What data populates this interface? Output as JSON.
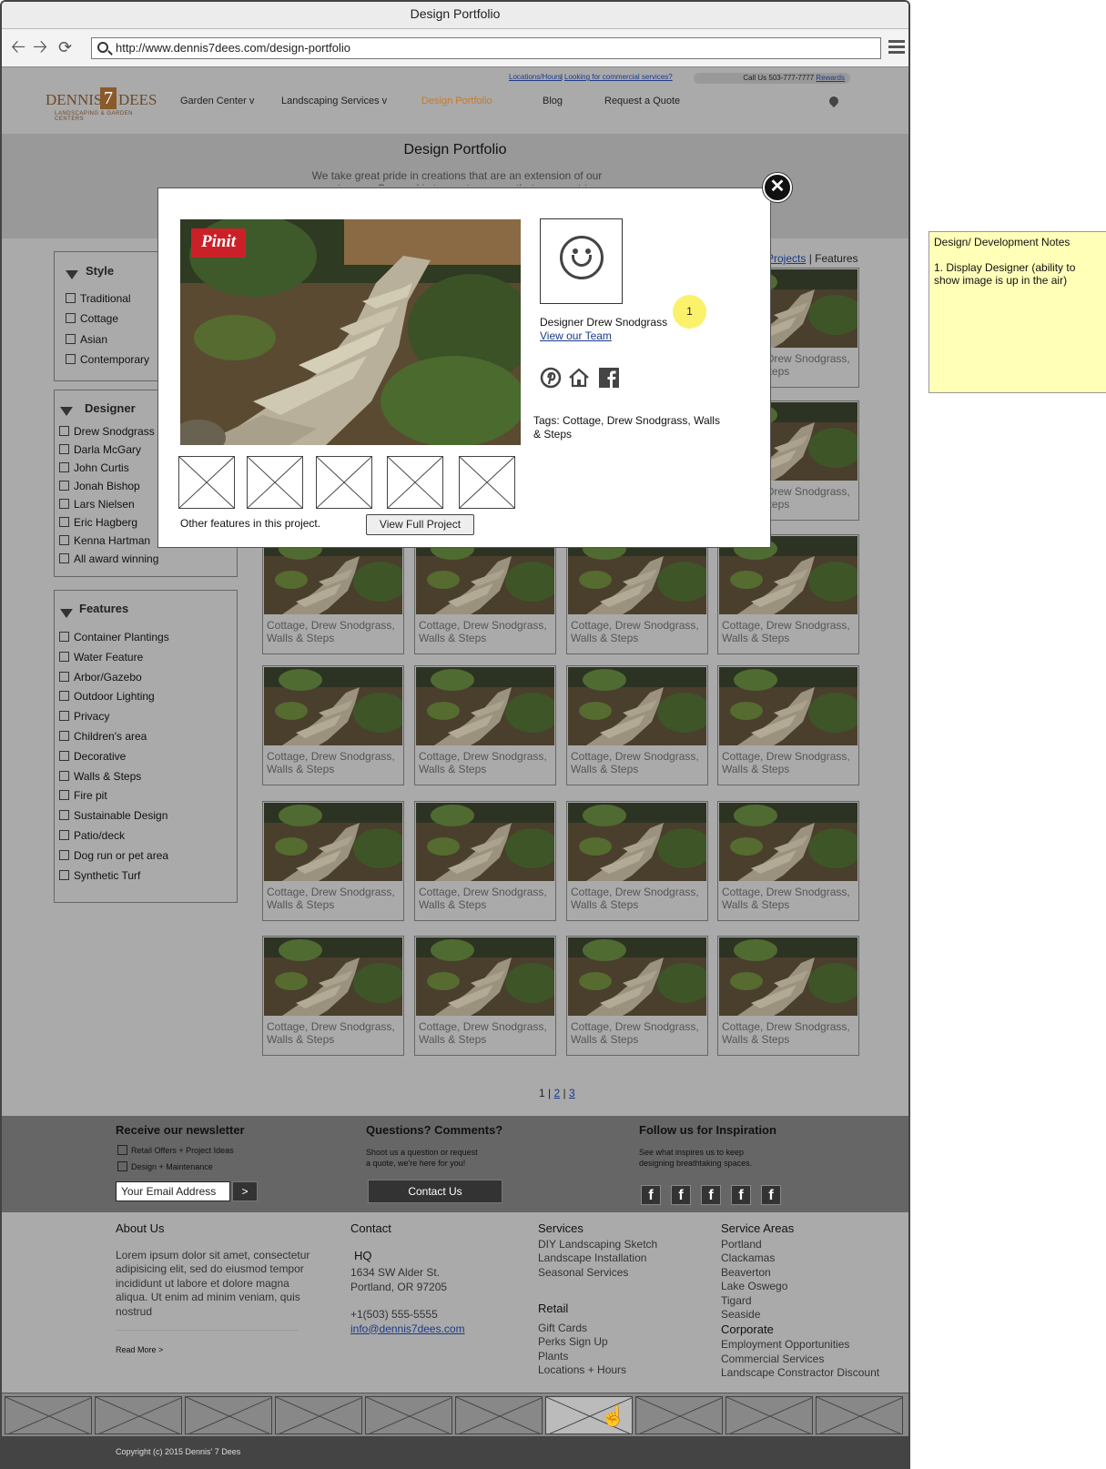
{
  "window": {
    "title": "Design Portfolio",
    "url": "http://www.dennis7dees.com/design-portfolio"
  },
  "header": {
    "top_links": [
      "Locations/Hours",
      "Looking for commercial services?"
    ],
    "top_sep": "|",
    "call_us": "Call Us 503-777-7777",
    "rewards": "Rewards",
    "logo": {
      "word1": "DENNIS'",
      "seven": "7",
      "word2": "DEES",
      "tagline": "LANDSCAPING & GARDEN CENTERS"
    },
    "nav": [
      "Garden Center v",
      "Landscaping Services v",
      "Design Portfolio",
      "Blog",
      "Request a Quote"
    ],
    "active_nav_color": "#c87a2a"
  },
  "banner": {
    "title": "Design Portfolio",
    "text": "We take great pride in creations that are an extension of our customers. Our goal is to create spaces that you want to"
  },
  "filters": {
    "style": {
      "title": "Style",
      "items": [
        "Traditional",
        "Cottage",
        "Asian",
        "Contemporary"
      ]
    },
    "designer": {
      "title": "Designer",
      "items": [
        "Drew Snodgrass",
        "Darla McGary",
        "John Curtis",
        "Jonah Bishop",
        "Lars Nielsen",
        "Eric Hagberg",
        "Kenna Hartman",
        "All award winning"
      ]
    },
    "features": {
      "title": "Features",
      "items": [
        "Container Plantings",
        "Water Feature",
        "Arbor/Gazebo",
        "Outdoor Lighting",
        "Privacy",
        "Children's area",
        "Decorative",
        "Walls & Steps",
        "Fire pit",
        "Sustainable Design",
        "Patio/deck",
        "Dog run or pet area",
        "Synthetic Turf"
      ]
    }
  },
  "view_toggle": {
    "projects": "Projects",
    "sep": " | ",
    "features": "Features"
  },
  "grid": {
    "caption_line1": "Cottage, Drew Snodgrass,",
    "caption_line2": "Walls & Steps"
  },
  "pagination": {
    "current": "1",
    "sep": " | ",
    "pages": [
      "2",
      "3"
    ]
  },
  "newsletter": {
    "title": "Receive our newsletter",
    "options": [
      "Retail Offers + Project Ideas",
      "Design + Maintenance"
    ],
    "email_placeholder": "Your Email Address",
    "submit": ">"
  },
  "questions": {
    "title": "Questions? Comments?",
    "text1": "Shoot us a question or request",
    "text2": "a quote, we're here for you!",
    "button": "Contact Us"
  },
  "follow": {
    "title": "Follow us for Inspiration",
    "text1": "See what inspires us to keep",
    "text2": "designing breathtaking spaces.",
    "icon": "facebook-icon",
    "glyph": "f"
  },
  "footer": {
    "about": {
      "title": "About Us",
      "text": "Lorem ipsum dolor sit amet, consectetur adipisicing elit, sed do eiusmod tempor incididunt ut labore et dolore magna aliqua. Ut enim ad minim veniam, quis nostrud",
      "read_more": "Read More >"
    },
    "contact": {
      "title": "Contact",
      "hq": "HQ",
      "addr1": "1634 SW Alder St.",
      "addr2": "Portland, OR 97205",
      "phone": "+1(503) 555-5555",
      "email": "info@dennis7dees.com"
    },
    "services": {
      "title": "Services",
      "items": [
        "DIY Landscaping Sketch",
        "Landscape Installation",
        "Seasonal Services"
      ]
    },
    "retail": {
      "title": "Retail",
      "items": [
        "Gift Cards",
        "Perks Sign Up",
        "Plants",
        "Locations + Hours"
      ]
    },
    "areas": {
      "title": "Service Areas",
      "items": [
        "Portland",
        "Clackamas",
        "Beaverton",
        "Lake Oswego",
        "Tigard",
        "Seaside"
      ]
    },
    "corporate": {
      "title": "Corporate",
      "items": [
        "Employment Opportunities",
        "Commercial Services",
        "Landscape Constractor Discount"
      ]
    }
  },
  "copyright": "Copyright (c) 2015 Dennis' 7 Dees",
  "modal": {
    "pinit": "Pinit",
    "designer": "Designer Drew Snodgrass",
    "view_team": "View our Team",
    "tags": "Tags: Cottage, Drew Snodgrass, Walls & Steps",
    "other_features": "Other features in this project.",
    "view_full": "View Full Project",
    "close_glyph": "✕",
    "social_icons": [
      "pinterest-icon",
      "houzz-icon",
      "facebook-icon"
    ]
  },
  "annotation": {
    "marker": "1"
  },
  "notes": {
    "title": "Design/ Development Notes",
    "text": "1. Display Designer (ability to show image is up in the air)"
  }
}
